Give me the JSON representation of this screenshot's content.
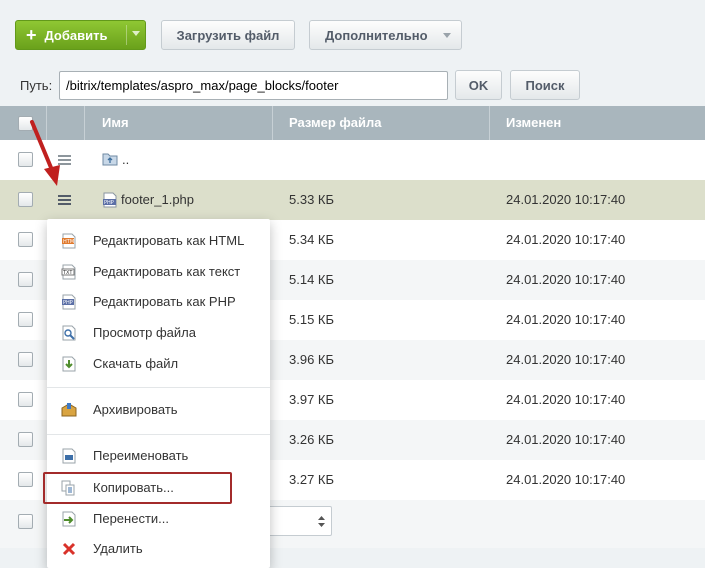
{
  "toolbar": {
    "add_label": "Добавить",
    "upload_label": "Загрузить файл",
    "more_label": "Дополнительно"
  },
  "path": {
    "label": "Путь:",
    "value": "/bitrix/templates/aspro_max/page_blocks/footer",
    "ok_label": "OK",
    "search_label": "Поиск"
  },
  "table": {
    "columns": [
      "Имя",
      "Размер файла",
      "Изменен"
    ],
    "up_label": "..",
    "rows": [
      {
        "name": "footer_1.php",
        "size": "5.33 КБ",
        "date": "24.01.2020 10:17:40"
      },
      {
        "name": "",
        "size": "5.34 КБ",
        "date": "24.01.2020 10:17:40"
      },
      {
        "name": "",
        "size": "5.14 КБ",
        "date": "24.01.2020 10:17:40"
      },
      {
        "name": "",
        "size": "5.15 КБ",
        "date": "24.01.2020 10:17:40"
      },
      {
        "name": "",
        "size": "3.96 КБ",
        "date": "24.01.2020 10:17:40"
      },
      {
        "name": "",
        "size": "3.97 КБ",
        "date": "24.01.2020 10:17:40"
      },
      {
        "name": "",
        "size": "3.26 КБ",
        "date": "24.01.2020 10:17:40"
      },
      {
        "name": "",
        "size": "3.27 КБ",
        "date": "24.01.2020 10:17:40"
      }
    ]
  },
  "context_menu": {
    "items": [
      {
        "label": "Редактировать как HTML",
        "icon": "edit-html-icon"
      },
      {
        "label": "Редактировать как текст",
        "icon": "edit-text-icon"
      },
      {
        "label": "Редактировать как PHP",
        "icon": "edit-php-icon"
      },
      {
        "label": "Просмотр файла",
        "icon": "view-file-icon"
      },
      {
        "label": "Скачать файл",
        "icon": "download-icon"
      },
      {
        "label": "Архивировать",
        "icon": "archive-icon"
      },
      {
        "label": "Переименовать",
        "icon": "rename-icon"
      },
      {
        "label": "Копировать...",
        "icon": "copy-icon"
      },
      {
        "label": "Перенести...",
        "icon": "move-icon"
      },
      {
        "label": "Удалить",
        "icon": "delete-icon"
      }
    ]
  },
  "colors": {
    "accent_green": "#7ab32a",
    "header_bg": "#a9b6bd",
    "selected_row": "#dcdfcb",
    "highlight_box": "#a32b2b",
    "arrow": "#c0201f"
  }
}
